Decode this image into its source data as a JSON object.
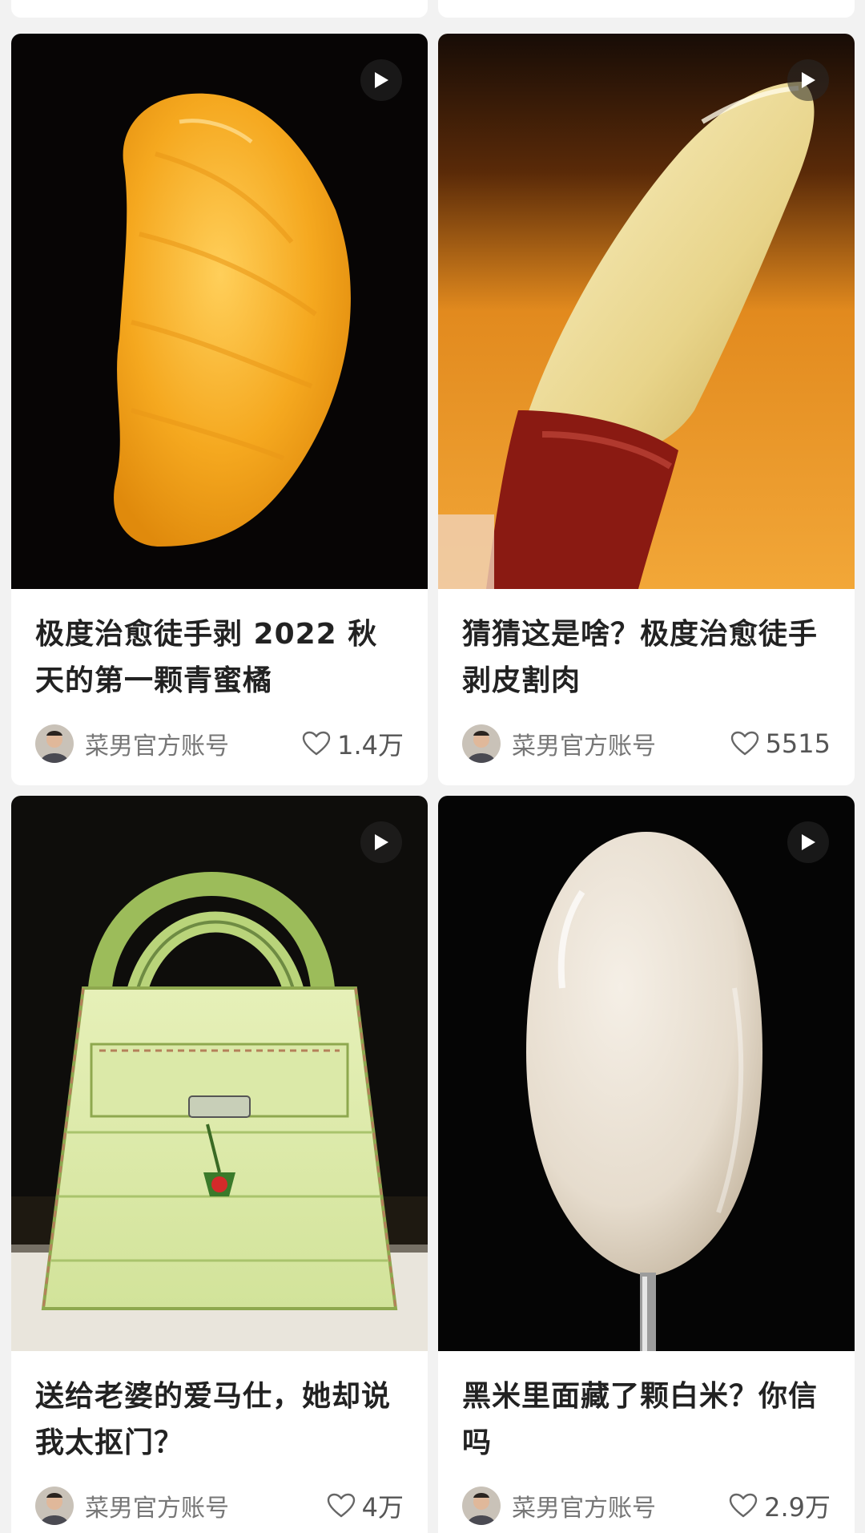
{
  "feed": {
    "cards": [
      {
        "title": "极度治愈徒手剥 2022 秋天的第一颗青蜜橘",
        "author": "菜男官方账号",
        "likes": "1.4万",
        "media_type": "video",
        "thumbnail": "orange-segment"
      },
      {
        "title": "猜猜这是啥？极度治愈徒手剥皮割肉",
        "author": "菜男官方账号",
        "likes": "5515",
        "media_type": "video",
        "thumbnail": "peeled-fruit"
      },
      {
        "title": "送给老婆的爱马仕，她却说我太抠门？",
        "author": "菜男官方账号",
        "likes": "4万",
        "media_type": "video",
        "thumbnail": "cucumber-handbag"
      },
      {
        "title": "黑米里面藏了颗白米？你信吗",
        "author": "菜男官方账号",
        "likes": "2.9万",
        "media_type": "video",
        "thumbnail": "white-rice-grain"
      }
    ]
  },
  "colors": {
    "background": "#f2f2f2",
    "card": "#ffffff",
    "title_text": "#222222",
    "meta_text": "#777777"
  },
  "icons": {
    "play": "play-icon",
    "like": "heart-outline-icon",
    "avatar": "author-avatar"
  }
}
